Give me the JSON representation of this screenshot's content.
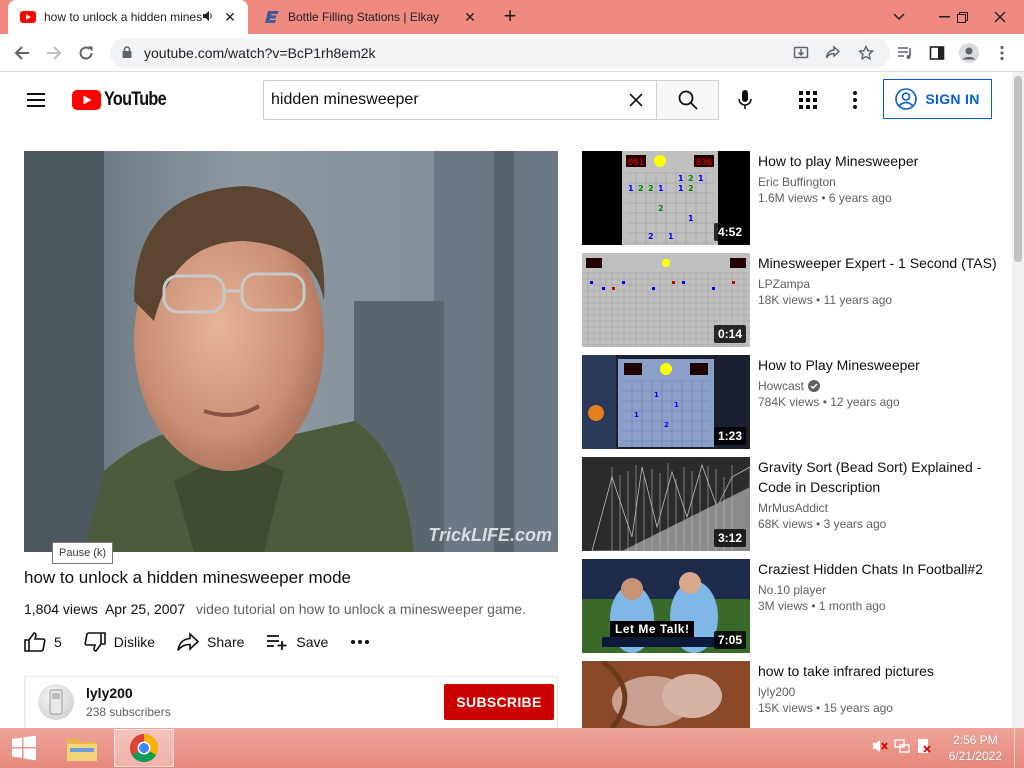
{
  "browser": {
    "tabs": [
      {
        "title": "how to unlock a hidden minesweeper mode - YouTube",
        "active": true
      },
      {
        "title": "Bottle Filling Stations | Elkay",
        "active": false
      }
    ],
    "new_tab_label": "+",
    "url": "youtube.com/watch?v=BcP1rh8em2k"
  },
  "youtube": {
    "logo_text": "YouTube",
    "search_value": "hidden minesweeper",
    "sign_in_label": "SIGN IN"
  },
  "video": {
    "watermark": "TrickLIFE.com",
    "tooltip": "Pause (k)",
    "title": "how to unlock a hidden minesweeper mode",
    "views": "1,804 views",
    "date": "Apr 25, 2007",
    "description": "video tutorial on how to unlock a minesweeper game.",
    "likes": "5",
    "dislike_label": "Dislike",
    "share_label": "Share",
    "save_label": "Save",
    "more_label": "..."
  },
  "channel": {
    "name": "lyly200",
    "subscribers": "238 subscribers",
    "subscribe_label": "SUBSCRIBE"
  },
  "related": [
    {
      "title": "How to play Minesweeper",
      "channel": "Eric Buffington",
      "verified": false,
      "views": "1.6M views",
      "age": "6 years ago",
      "duration": "4:52"
    },
    {
      "title": "Minesweeper Expert - 1 Second (TAS)",
      "channel": "LPZampa",
      "verified": false,
      "views": "18K views",
      "age": "11 years ago",
      "duration": "0:14"
    },
    {
      "title": "How to Play Minesweeper",
      "channel": "Howcast",
      "verified": true,
      "views": "784K views",
      "age": "12 years ago",
      "duration": "1:23"
    },
    {
      "title": "Gravity Sort (Bead Sort) Explained - Code in Description",
      "channel": "MrMusAddict",
      "verified": false,
      "views": "68K views",
      "age": "3 years ago",
      "duration": "3:12"
    },
    {
      "title": "Craziest Hidden Chats In Football#2",
      "channel": "No.10 player",
      "verified": false,
      "views": "3M views",
      "age": "1 month ago",
      "duration": "7:05",
      "thumb_caption": "Let Me Talk!"
    },
    {
      "title": "how to take infrared pictures",
      "channel": "lyly200",
      "verified": false,
      "views": "15K views",
      "age": "15 years ago",
      "duration": ""
    }
  ],
  "taskbar": {
    "time": "2:56 PM",
    "date": "6/21/2022"
  },
  "colors": {
    "youtube_red": "#ff0000",
    "subscribe_red": "#cc0000",
    "sign_in_blue": "#065fd4",
    "tabstrip": "#f08a80"
  }
}
